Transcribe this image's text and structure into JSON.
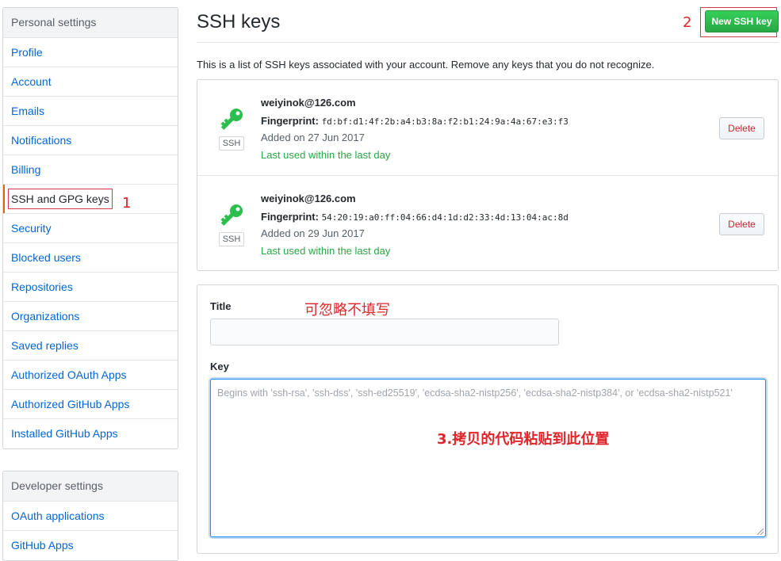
{
  "sidebar": {
    "personal_heading": "Personal settings",
    "items": [
      "Profile",
      "Account",
      "Emails",
      "Notifications",
      "Billing",
      "SSH and GPG keys",
      "Security",
      "Blocked users",
      "Repositories",
      "Organizations",
      "Saved replies",
      "Authorized OAuth Apps",
      "Authorized GitHub Apps",
      "Installed GitHub Apps"
    ],
    "selected": "SSH and GPG keys",
    "developer_heading": "Developer settings",
    "developer_items": [
      "OAuth applications",
      "GitHub Apps"
    ]
  },
  "annotations": {
    "step1": "1",
    "step2": "2",
    "title_hint": "可忽略不填写",
    "key_hint": "3.拷贝的代码粘贴到此位置"
  },
  "main": {
    "title": "SSH keys",
    "new_key_button": "New SSH key",
    "intro": "This is a list of SSH keys associated with your account. Remove any keys that you do not recognize.",
    "keys": [
      {
        "title": "weiyinok@126.com",
        "fingerprint_label": "Fingerprint:",
        "fingerprint": "fd:bf:d1:4f:2b:a4:b3:8a:f2:b1:24:9a:4a:67:e3:f3",
        "added": "Added on 27 Jun 2017",
        "last_used": "Last used within the last day",
        "badge": "SSH",
        "delete_label": "Delete"
      },
      {
        "title": "weiyinok@126.com",
        "fingerprint_label": "Fingerprint:",
        "fingerprint": "54:20:19:a0:ff:04:66:d4:1d:d2:33:4d:13:04:ac:8d",
        "added": "Added on 29 Jun 2017",
        "last_used": "Last used within the last day",
        "badge": "SSH",
        "delete_label": "Delete"
      }
    ],
    "form": {
      "title_label": "Title",
      "title_value": "",
      "key_label": "Key",
      "key_placeholder": "Begins with 'ssh-rsa', 'ssh-dss', 'ssh-ed25519', 'ecdsa-sha2-nistp256', 'ecdsa-sha2-nistp384', or 'ecdsa-sha2-nistp521'"
    }
  },
  "colors": {
    "link": "#0366d6",
    "green": "#28a745",
    "key_icon": "#2cbe4e",
    "annotation_red": "#e0242a",
    "danger": "#cb2431"
  },
  "icons": {
    "key": "key-icon"
  }
}
